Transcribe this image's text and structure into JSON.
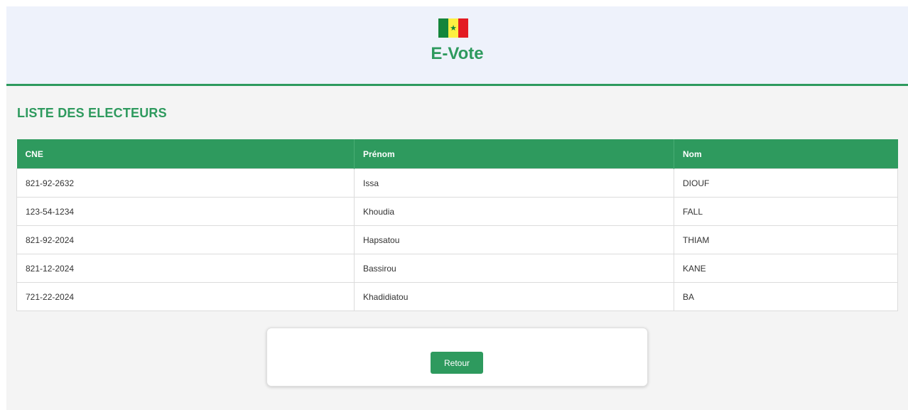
{
  "colors": {
    "accent": "#2e9a5e",
    "header_bg": "#eef2fb",
    "flag_green": "#14853b",
    "flag_yellow": "#fdef42",
    "flag_red": "#e31b23"
  },
  "header": {
    "flag_icon": "senegal-flag-icon",
    "flag_star": "★",
    "app_title": "E-Vote"
  },
  "main": {
    "section_title": "LISTE DES ELECTEURS",
    "table": {
      "columns": [
        "CNE",
        "Prénom",
        "Nom"
      ],
      "rows": [
        [
          "821-92-2632",
          "Issa",
          "DIOUF"
        ],
        [
          "123-54-1234",
          "Khoudia",
          "FALL"
        ],
        [
          "821-92-2024",
          "Hapsatou",
          "THIAM"
        ],
        [
          "821-12-2024",
          "Bassirou",
          "KANE"
        ],
        [
          "721-22-2024",
          "Khadidiatou",
          "BA"
        ]
      ]
    },
    "back_button_label": "Retour"
  }
}
